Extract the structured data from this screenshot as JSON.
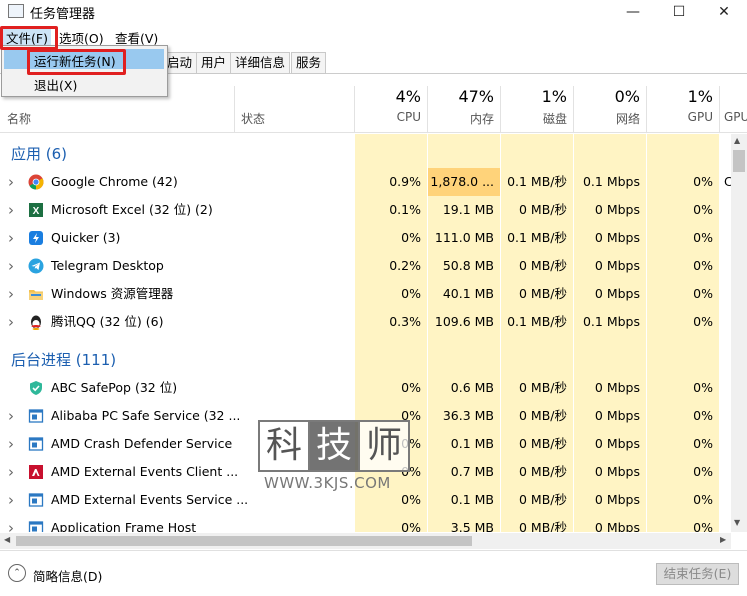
{
  "window": {
    "title": "任务管理器",
    "minimize": "—",
    "maximize": "☐",
    "close": "✕"
  },
  "menubar": [
    {
      "label": "文件(F)"
    },
    {
      "label": "选项(O)"
    },
    {
      "label": "查看(V)"
    }
  ],
  "file_menu": {
    "run_new_task": "运行新任务(N)",
    "exit": "退出(X)"
  },
  "tabs": [
    {
      "label": "启动"
    },
    {
      "label": "用户"
    },
    {
      "label": "详细信息"
    },
    {
      "label": "服务"
    }
  ],
  "columns": {
    "name": "名称",
    "status": "状态",
    "cpu": {
      "pct": "4%",
      "label": "CPU"
    },
    "mem": {
      "pct": "47%",
      "label": "内存"
    },
    "disk": {
      "pct": "1%",
      "label": "磁盘"
    },
    "net": {
      "pct": "0%",
      "label": "网络"
    },
    "gpu": {
      "pct": "1%",
      "label": "GPU"
    },
    "gpu_engine": {
      "label": "GPU"
    }
  },
  "groups": {
    "apps": "应用 (6)",
    "background": "后台进程 (111)"
  },
  "apps": [
    {
      "name": "Google Chrome (42)",
      "cpu": "0.9%",
      "mem": "1,878.0 ...",
      "disk": "0.1 MB/秒",
      "net": "0.1 Mbps",
      "gpu": "0%",
      "gpu_engine": "C",
      "icon": "chrome-icon"
    },
    {
      "name": "Microsoft Excel (32 位) (2)",
      "cpu": "0.1%",
      "mem": "19.1 MB",
      "disk": "0 MB/秒",
      "net": "0 Mbps",
      "gpu": "0%",
      "icon": "excel-icon"
    },
    {
      "name": "Quicker (3)",
      "cpu": "0%",
      "mem": "111.0 MB",
      "disk": "0.1 MB/秒",
      "net": "0 Mbps",
      "gpu": "0%",
      "icon": "quicker-icon"
    },
    {
      "name": "Telegram Desktop",
      "cpu": "0.2%",
      "mem": "50.8 MB",
      "disk": "0 MB/秒",
      "net": "0 Mbps",
      "gpu": "0%",
      "icon": "telegram-icon"
    },
    {
      "name": "Windows 资源管理器",
      "cpu": "0%",
      "mem": "40.1 MB",
      "disk": "0 MB/秒",
      "net": "0 Mbps",
      "gpu": "0%",
      "icon": "folder-icon"
    },
    {
      "name": "腾讯QQ (32 位) (6)",
      "cpu": "0.3%",
      "mem": "109.6 MB",
      "disk": "0.1 MB/秒",
      "net": "0.1 Mbps",
      "gpu": "0%",
      "icon": "qq-icon"
    }
  ],
  "background": [
    {
      "name": "ABC SafePop (32 位)",
      "cpu": "0%",
      "mem": "0.6 MB",
      "disk": "0 MB/秒",
      "net": "0 Mbps",
      "gpu": "0%",
      "icon": "shield-icon"
    },
    {
      "name": "Alibaba PC Safe Service (32 ...",
      "cpu": "0%",
      "mem": "36.3 MB",
      "disk": "0 MB/秒",
      "net": "0 Mbps",
      "gpu": "0%",
      "icon": "service-icon"
    },
    {
      "name": "AMD Crash Defender Service",
      "cpu": "0%",
      "mem": "0.1 MB",
      "disk": "0 MB/秒",
      "net": "0 Mbps",
      "gpu": "0%",
      "icon": "service-icon"
    },
    {
      "name": "AMD External Events Client ...",
      "cpu": "0%",
      "mem": "0.7 MB",
      "disk": "0 MB/秒",
      "net": "0 Mbps",
      "gpu": "0%",
      "icon": "amd-icon"
    },
    {
      "name": "AMD External Events Service ...",
      "cpu": "0%",
      "mem": "0.1 MB",
      "disk": "0 MB/秒",
      "net": "0 Mbps",
      "gpu": "0%",
      "icon": "service-icon"
    },
    {
      "name": "Application Frame Host",
      "cpu": "0%",
      "mem": "3.5 MB",
      "disk": "0 MB/秒",
      "net": "0 Mbps",
      "gpu": "0%",
      "icon": "service-icon"
    }
  ],
  "footer": {
    "fewer_details": "简略信息(D)",
    "end_task": "结束任务(E)"
  },
  "watermark": {
    "chars": [
      "科",
      "技",
      "师"
    ],
    "url": "WWW.3KJS.COM"
  },
  "colors": {
    "heat_light": "#fff4c4",
    "heat_hot": "#ffd37a",
    "group_blue": "#1c5fb0",
    "menu_select": "#99c9ef",
    "highlight": "#e02020"
  }
}
